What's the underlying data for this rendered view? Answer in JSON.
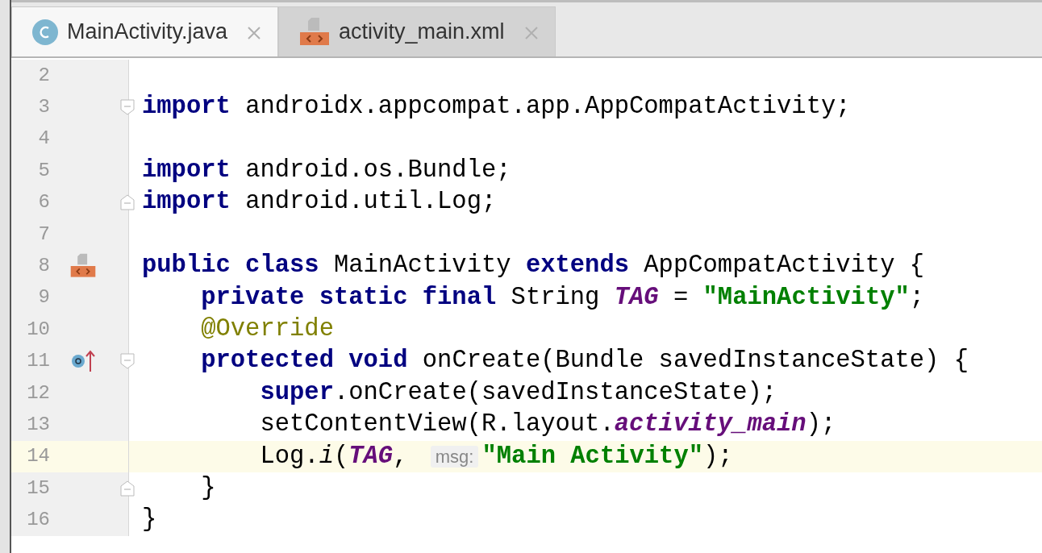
{
  "tabs": [
    {
      "label": "MainActivity.java",
      "kind": "class",
      "selected": true
    },
    {
      "label": "activity_main.xml",
      "kind": "layout",
      "selected": false
    }
  ],
  "lines": [
    {
      "number": "2",
      "kind": "plain",
      "current": false
    },
    {
      "number": "3",
      "kind": "fold-start",
      "current": false,
      "tokens": [
        {
          "kind": "keyword",
          "text": "import"
        },
        {
          "kind": "plain",
          "text": " androidx.appcompat.app.AppCompatActivity;"
        }
      ]
    },
    {
      "number": "4",
      "kind": "plain",
      "current": false
    },
    {
      "number": "5",
      "kind": "plain",
      "current": false,
      "tokens": [
        {
          "kind": "keyword",
          "text": "import"
        },
        {
          "kind": "plain",
          "text": " android.os.Bundle;"
        }
      ]
    },
    {
      "number": "6",
      "kind": "fold-end",
      "current": false,
      "tokens": [
        {
          "kind": "keyword",
          "text": "import"
        },
        {
          "kind": "plain",
          "text": " android.util.Log;"
        }
      ]
    },
    {
      "number": "7",
      "kind": "plain",
      "current": false
    },
    {
      "number": "8",
      "kind": "layout-link",
      "current": false,
      "tokens": [
        {
          "kind": "keyword",
          "text": "public class"
        },
        {
          "kind": "plain",
          "text": " MainActivity "
        },
        {
          "kind": "keyword",
          "text": "extends"
        },
        {
          "kind": "plain",
          "text": " AppCompatActivity {"
        }
      ]
    },
    {
      "number": "9",
      "kind": "plain",
      "current": false,
      "tokens": [
        {
          "kind": "keyword",
          "text": "    private static final"
        },
        {
          "kind": "plain",
          "text": " String "
        },
        {
          "kind": "constant",
          "text": "TAG"
        },
        {
          "kind": "plain",
          "text": " = "
        },
        {
          "kind": "string",
          "text": "\"MainActivity\""
        },
        {
          "kind": "plain",
          "text": ";"
        }
      ]
    },
    {
      "number": "10",
      "kind": "plain",
      "current": false,
      "tokens": [
        {
          "kind": "annotation",
          "text": "    @Override"
        }
      ]
    },
    {
      "number": "11",
      "kind": "override",
      "current": false,
      "tokens": [
        {
          "kind": "keyword",
          "text": "    protected void"
        },
        {
          "kind": "plain",
          "text": " onCreate(Bundle savedInstanceState) {"
        }
      ]
    },
    {
      "number": "12",
      "kind": "plain",
      "current": false,
      "tokens": [
        {
          "kind": "keyword",
          "text": "        super"
        },
        {
          "kind": "plain",
          "text": ".onCreate(savedInstanceState);"
        }
      ]
    },
    {
      "number": "13",
      "kind": "plain",
      "current": false,
      "tokens": [
        {
          "kind": "plain",
          "text": "        setContentView(R.layout."
        },
        {
          "kind": "constant",
          "text": "activity_main"
        },
        {
          "kind": "plain",
          "text": ");"
        }
      ]
    },
    {
      "number": "14",
      "kind": "plain",
      "current": true,
      "tokens": [
        {
          "kind": "plain",
          "text": "        Log."
        },
        {
          "kind": "static-method",
          "text": "i"
        },
        {
          "kind": "plain",
          "text": "("
        },
        {
          "kind": "constant",
          "text": "TAG"
        },
        {
          "kind": "plain",
          "text": ", "
        },
        {
          "kind": "hint",
          "text": "msg:"
        },
        {
          "kind": "string",
          "text": "\"Main Activity\""
        },
        {
          "kind": "plain",
          "text": ");"
        }
      ]
    },
    {
      "number": "15",
      "kind": "fold-end",
      "current": false,
      "tokens": [
        {
          "kind": "plain",
          "text": "    }"
        }
      ]
    },
    {
      "number": "16",
      "kind": "plain",
      "current": false,
      "tokens": [
        {
          "kind": "plain",
          "text": "}"
        }
      ]
    }
  ]
}
